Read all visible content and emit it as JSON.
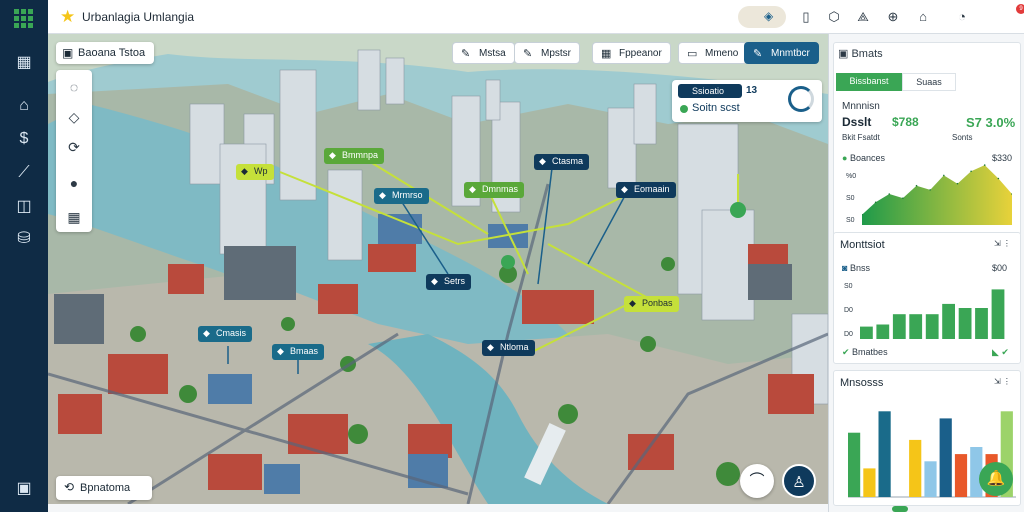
{
  "app": {
    "title": "Urbanlagia Umlangia",
    "top_icons": [
      "grid-menu-icon",
      "star-icon",
      "map-pin-icon",
      "clipboard-icon",
      "shield-icon",
      "translate-icon",
      "gamepad-icon",
      "home-icon",
      "bell-icon"
    ],
    "notification_count": "9"
  },
  "sidebar": {
    "icons": [
      "grid-menu-icon",
      "map-icon",
      "home-icon",
      "dollar-icon",
      "chart-icon",
      "layers-icon",
      "database-icon",
      "export-icon"
    ]
  },
  "map": {
    "title": "Baoana Tstoa",
    "toolbar": [
      {
        "label": "Mstsa",
        "icon": "pencil-icon"
      },
      {
        "label": "Mpstsr",
        "icon": "pencil-icon"
      },
      {
        "label": "Fppeanor",
        "icon": "grid-icon"
      },
      {
        "label": "Mmeno",
        "icon": "image-icon"
      },
      {
        "label": "Mnmtbcr",
        "icon": "pencil-icon"
      }
    ],
    "tools": [
      "lasso-icon",
      "polygon-icon",
      "transform-icon",
      "blob-icon",
      "table-icon"
    ],
    "info_card": {
      "tag": "Ssioatio",
      "value": "13",
      "subtitle": "Soitn scst"
    },
    "labels": [
      {
        "text": "Wp",
        "style": "lime"
      },
      {
        "text": "Bmmnpa",
        "style": "green"
      },
      {
        "text": "Ctasma",
        "style": "navy"
      },
      {
        "text": "Mrmrso",
        "style": "teal"
      },
      {
        "text": "Dmnmas",
        "style": "green"
      },
      {
        "text": "Eomaain",
        "style": "navy"
      },
      {
        "text": "Setrs",
        "style": "navy"
      },
      {
        "text": "Cmasis",
        "style": "teal"
      },
      {
        "text": "Bmaas",
        "style": "teal"
      },
      {
        "text": "Ntloma",
        "style": "navy"
      },
      {
        "text": "Ponbas",
        "style": "lime"
      }
    ],
    "search_label": "Bpnatoma"
  },
  "panel": {
    "header": "Bmats",
    "tabs": [
      "Bissbanst",
      "Suaas"
    ],
    "summary": {
      "left_label": "Mnnnisn",
      "left_value": "Dsslt",
      "left_suffix": "$788",
      "right_value": "S7 3.0%",
      "small_left": "Bkit Fsatdt",
      "small_right": "Sonts"
    },
    "card1": {
      "label": "Boances",
      "value": "$330",
      "ticks": [
        "%0",
        "S0",
        "S0"
      ]
    },
    "card2": {
      "title": "Monttsiot",
      "value": "$00",
      "label": "Bnss",
      "ticks": [
        "S0",
        "D0",
        "D0"
      ],
      "footer": "Bmatbes"
    },
    "card3": {
      "title": "Mnsosss"
    }
  },
  "chart_data": [
    {
      "type": "area",
      "title": "Boances",
      "x": [
        0,
        1,
        2,
        3,
        4,
        5,
        6,
        7,
        8,
        9,
        10,
        11
      ],
      "values": [
        10,
        22,
        30,
        26,
        38,
        34,
        48,
        40,
        52,
        58,
        45,
        30
      ],
      "ylim": [
        0,
        60
      ]
    },
    {
      "type": "bar",
      "title": "Monttsiot",
      "categories": [
        "1",
        "2",
        "3",
        "4",
        "5",
        "6",
        "7",
        "8",
        "9"
      ],
      "values": [
        12,
        14,
        24,
        24,
        24,
        34,
        30,
        30,
        48
      ],
      "ylim": [
        0,
        60
      ]
    },
    {
      "type": "bar",
      "title": "Mnsosss",
      "categories": [
        "1",
        "2",
        "3",
        "4",
        "5",
        "6",
        "7",
        "8",
        "9",
        "10",
        "11"
      ],
      "series": [
        {
          "values": [
            45,
            20,
            60,
            0,
            40,
            25,
            55,
            30,
            35,
            30,
            60
          ]
        }
      ],
      "colors": [
        "#3aa655",
        "#f5c518",
        "#1a6b8a",
        "#8fc7e8",
        "#f5c518",
        "#8fc7e8",
        "#1a5f8a",
        "#e8582a",
        "#8fc7e8",
        "#e8582a",
        "#9cd36a"
      ],
      "ylim": [
        0,
        70
      ]
    }
  ],
  "colors": {
    "accent": "#3aa655",
    "navy": "#0f2b45",
    "map_water": "#8fc3c9"
  }
}
